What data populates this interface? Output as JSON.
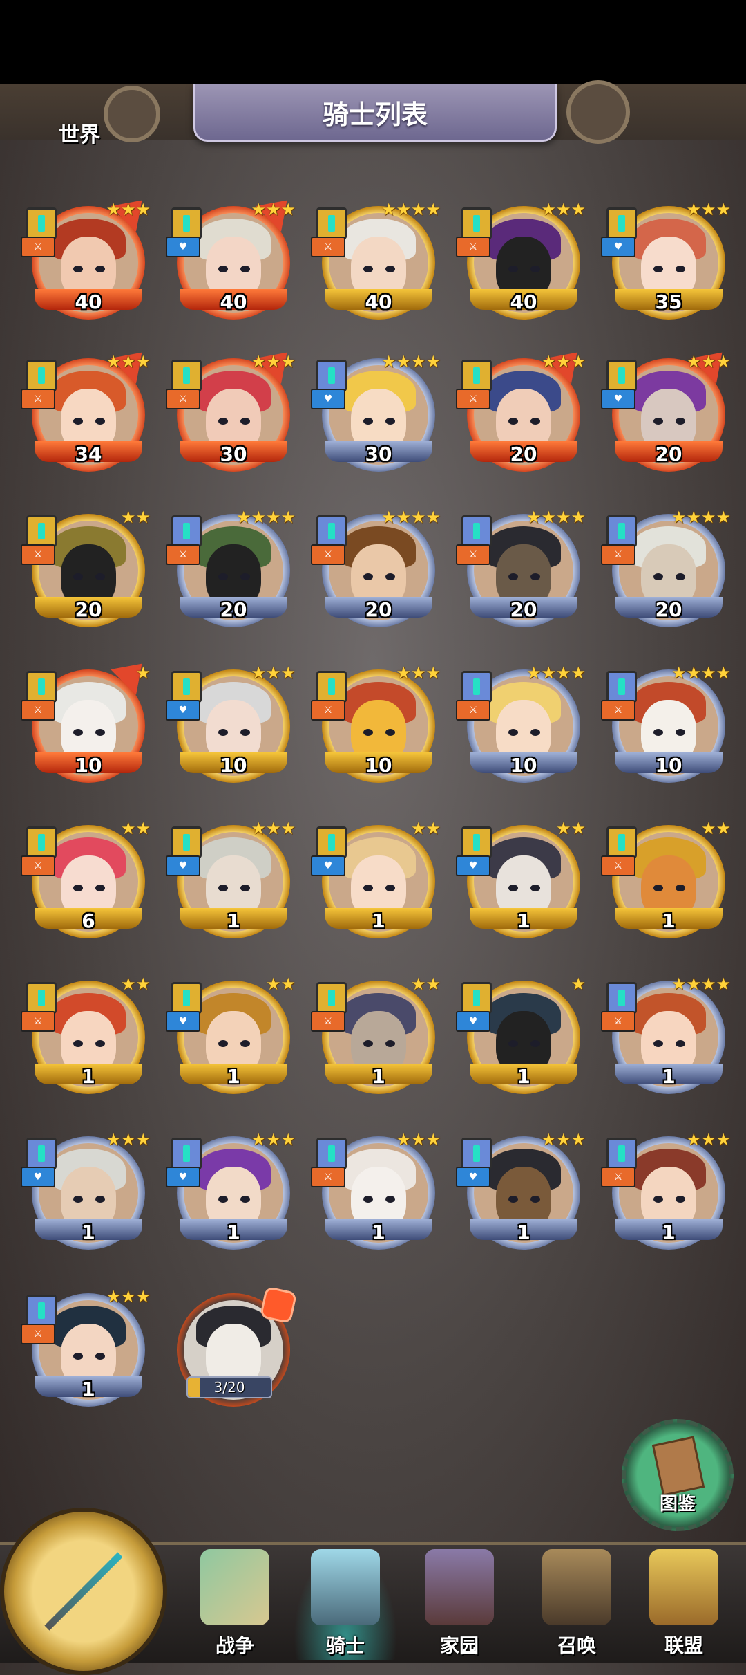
{
  "header": {
    "title": "骑士列表"
  },
  "knights": [
    {
      "level": "40",
      "stars": "★★★",
      "tier": "red",
      "role": "atk",
      "hair": "#b33a22",
      "skin": "#f1c9b0",
      "badge": true
    },
    {
      "level": "40",
      "stars": "★★★",
      "tier": "red",
      "role": "def",
      "hair": "#e0dcd0",
      "skin": "#f3d6c6",
      "badge": true
    },
    {
      "level": "40",
      "stars": "★★★★",
      "tier": "gold",
      "role": "atk",
      "hair": "#e9e6e0",
      "skin": "#f3d8c4",
      "badge": false
    },
    {
      "level": "40",
      "stars": "★★★",
      "tier": "gold",
      "role": "atk",
      "hair": "#5a2a7a",
      "skin": "#222",
      "badge": false
    },
    {
      "level": "35",
      "stars": "★★★",
      "tier": "gold",
      "role": "def",
      "hair": "#d4664a",
      "skin": "#f7dccc",
      "badge": false
    },
    {
      "level": "34",
      "stars": "★★★",
      "tier": "red",
      "role": "atk",
      "hair": "#d85a2a",
      "skin": "#f7d8c2",
      "badge": true
    },
    {
      "level": "30",
      "stars": "★★★",
      "tier": "red",
      "role": "atk",
      "hair": "#d23f4a",
      "skin": "#f1cbb8",
      "badge": true
    },
    {
      "level": "30",
      "stars": "★★★★",
      "tier": "silver",
      "role": "def",
      "hair": "#f1c84a",
      "skin": "#f7dcc4",
      "badge": false
    },
    {
      "level": "20",
      "stars": "★★★",
      "tier": "red",
      "role": "atk",
      "hair": "#3b4a8a",
      "skin": "#f0cdb8",
      "badge": true
    },
    {
      "level": "20",
      "stars": "★★★",
      "tier": "red",
      "role": "def",
      "hair": "#7c3aa0",
      "skin": "#d8c8c0",
      "badge": true
    },
    {
      "level": "20",
      "stars": "★★",
      "tier": "gold",
      "role": "atk",
      "hair": "#8a7a30",
      "skin": "#222",
      "badge": false
    },
    {
      "level": "20",
      "stars": "★★★★",
      "tier": "silver",
      "role": "atk",
      "hair": "#4a6a3a",
      "skin": "#222",
      "badge": false
    },
    {
      "level": "20",
      "stars": "★★★★",
      "tier": "silver",
      "role": "atk",
      "hair": "#7a4a22",
      "skin": "#eac8a8",
      "badge": false
    },
    {
      "level": "20",
      "stars": "★★★★",
      "tier": "silver",
      "role": "atk",
      "hair": "#2a2a30",
      "skin": "#6a5a48",
      "badge": false
    },
    {
      "level": "20",
      "stars": "★★★★",
      "tier": "silver",
      "role": "atk",
      "hair": "#e2e2da",
      "skin": "#d8cab8",
      "badge": false
    },
    {
      "level": "10",
      "stars": "★",
      "tier": "red",
      "role": "atk",
      "hair": "#e8e8e4",
      "skin": "#f4f0ec",
      "badge": true
    },
    {
      "level": "10",
      "stars": "★★★",
      "tier": "gold",
      "role": "def",
      "hair": "#d8d8d8",
      "skin": "#f2dcd0",
      "badge": false
    },
    {
      "level": "10",
      "stars": "★★★",
      "tier": "gold",
      "role": "atk",
      "hair": "#c44a2a",
      "skin": "#f2b83a",
      "badge": false
    },
    {
      "level": "10",
      "stars": "★★★★",
      "tier": "silver",
      "role": "atk",
      "hair": "#f0d070",
      "skin": "#f7dcc6",
      "badge": false
    },
    {
      "level": "10",
      "stars": "★★★★",
      "tier": "silver",
      "role": "atk",
      "hair": "#c24a2a",
      "skin": "#f4f0ea",
      "badge": false
    },
    {
      "level": "6",
      "stars": "★★",
      "tier": "gold",
      "role": "atk",
      "hair": "#e24a5e",
      "skin": "#f7dcd0",
      "badge": false
    },
    {
      "level": "1",
      "stars": "★★★",
      "tier": "gold",
      "role": "def",
      "hair": "#cfcfc6",
      "skin": "#e8dcd0",
      "badge": false
    },
    {
      "level": "1",
      "stars": "★★",
      "tier": "gold",
      "role": "def",
      "hair": "#e8c890",
      "skin": "#f7dcc8",
      "badge": false
    },
    {
      "level": "1",
      "stars": "★★",
      "tier": "gold",
      "role": "def",
      "hair": "#3c3a48",
      "skin": "#e8e2dc",
      "badge": false
    },
    {
      "level": "1",
      "stars": "★★",
      "tier": "gold",
      "role": "atk",
      "hair": "#d8a02a",
      "skin": "#e08a3a",
      "badge": false
    },
    {
      "level": "1",
      "stars": "★★",
      "tier": "gold",
      "role": "atk",
      "hair": "#d24a2a",
      "skin": "#f7d6c0",
      "badge": false
    },
    {
      "level": "1",
      "stars": "★★",
      "tier": "gold",
      "role": "def",
      "hair": "#c2862a",
      "skin": "#f3d2b8",
      "badge": false
    },
    {
      "level": "1",
      "stars": "★★",
      "tier": "gold",
      "role": "atk",
      "hair": "#4a4a6a",
      "skin": "#b8a898",
      "badge": false
    },
    {
      "level": "1",
      "stars": "★",
      "tier": "gold",
      "role": "def",
      "hair": "#2a3a4a",
      "skin": "#222",
      "badge": false
    },
    {
      "level": "1",
      "stars": "★★★★",
      "tier": "silver",
      "role": "atk",
      "hair": "#c2542a",
      "skin": "#f7d6c0",
      "badge": false
    },
    {
      "level": "1",
      "stars": "★★★",
      "tier": "silver",
      "role": "def",
      "hair": "#d8d8d2",
      "skin": "#e6ccb4",
      "badge": false
    },
    {
      "level": "1",
      "stars": "★★★",
      "tier": "silver",
      "role": "def",
      "hair": "#7a3aa8",
      "skin": "#f2dac8",
      "badge": false
    },
    {
      "level": "1",
      "stars": "★★★",
      "tier": "silver",
      "role": "atk",
      "hair": "#ece6e0",
      "skin": "#f4f0ec",
      "badge": false
    },
    {
      "level": "1",
      "stars": "★★★",
      "tier": "silver",
      "role": "def",
      "hair": "#2a2a30",
      "skin": "#7a5a3a",
      "badge": false
    },
    {
      "level": "1",
      "stars": "★★★",
      "tier": "silver",
      "role": "atk",
      "hair": "#8a3a2a",
      "skin": "#f4d6c0",
      "badge": false
    },
    {
      "level": "1",
      "stars": "★★★",
      "tier": "silver",
      "role": "atk",
      "hair": "#203040",
      "skin": "#f3d6c2",
      "badge": false
    }
  ],
  "locked_knight": {
    "progress": "3/20",
    "progress_value": 0.15
  },
  "codex_button": {
    "label": "图鉴"
  },
  "nav": {
    "world": "世界",
    "battle": "战争",
    "knights": "骑士",
    "home": "家园",
    "summon": "召唤",
    "alliance": "联盟"
  },
  "colors": {
    "accent": "#e7b234",
    "rare_red": "#d13b17",
    "teal": "#25e0c5"
  }
}
